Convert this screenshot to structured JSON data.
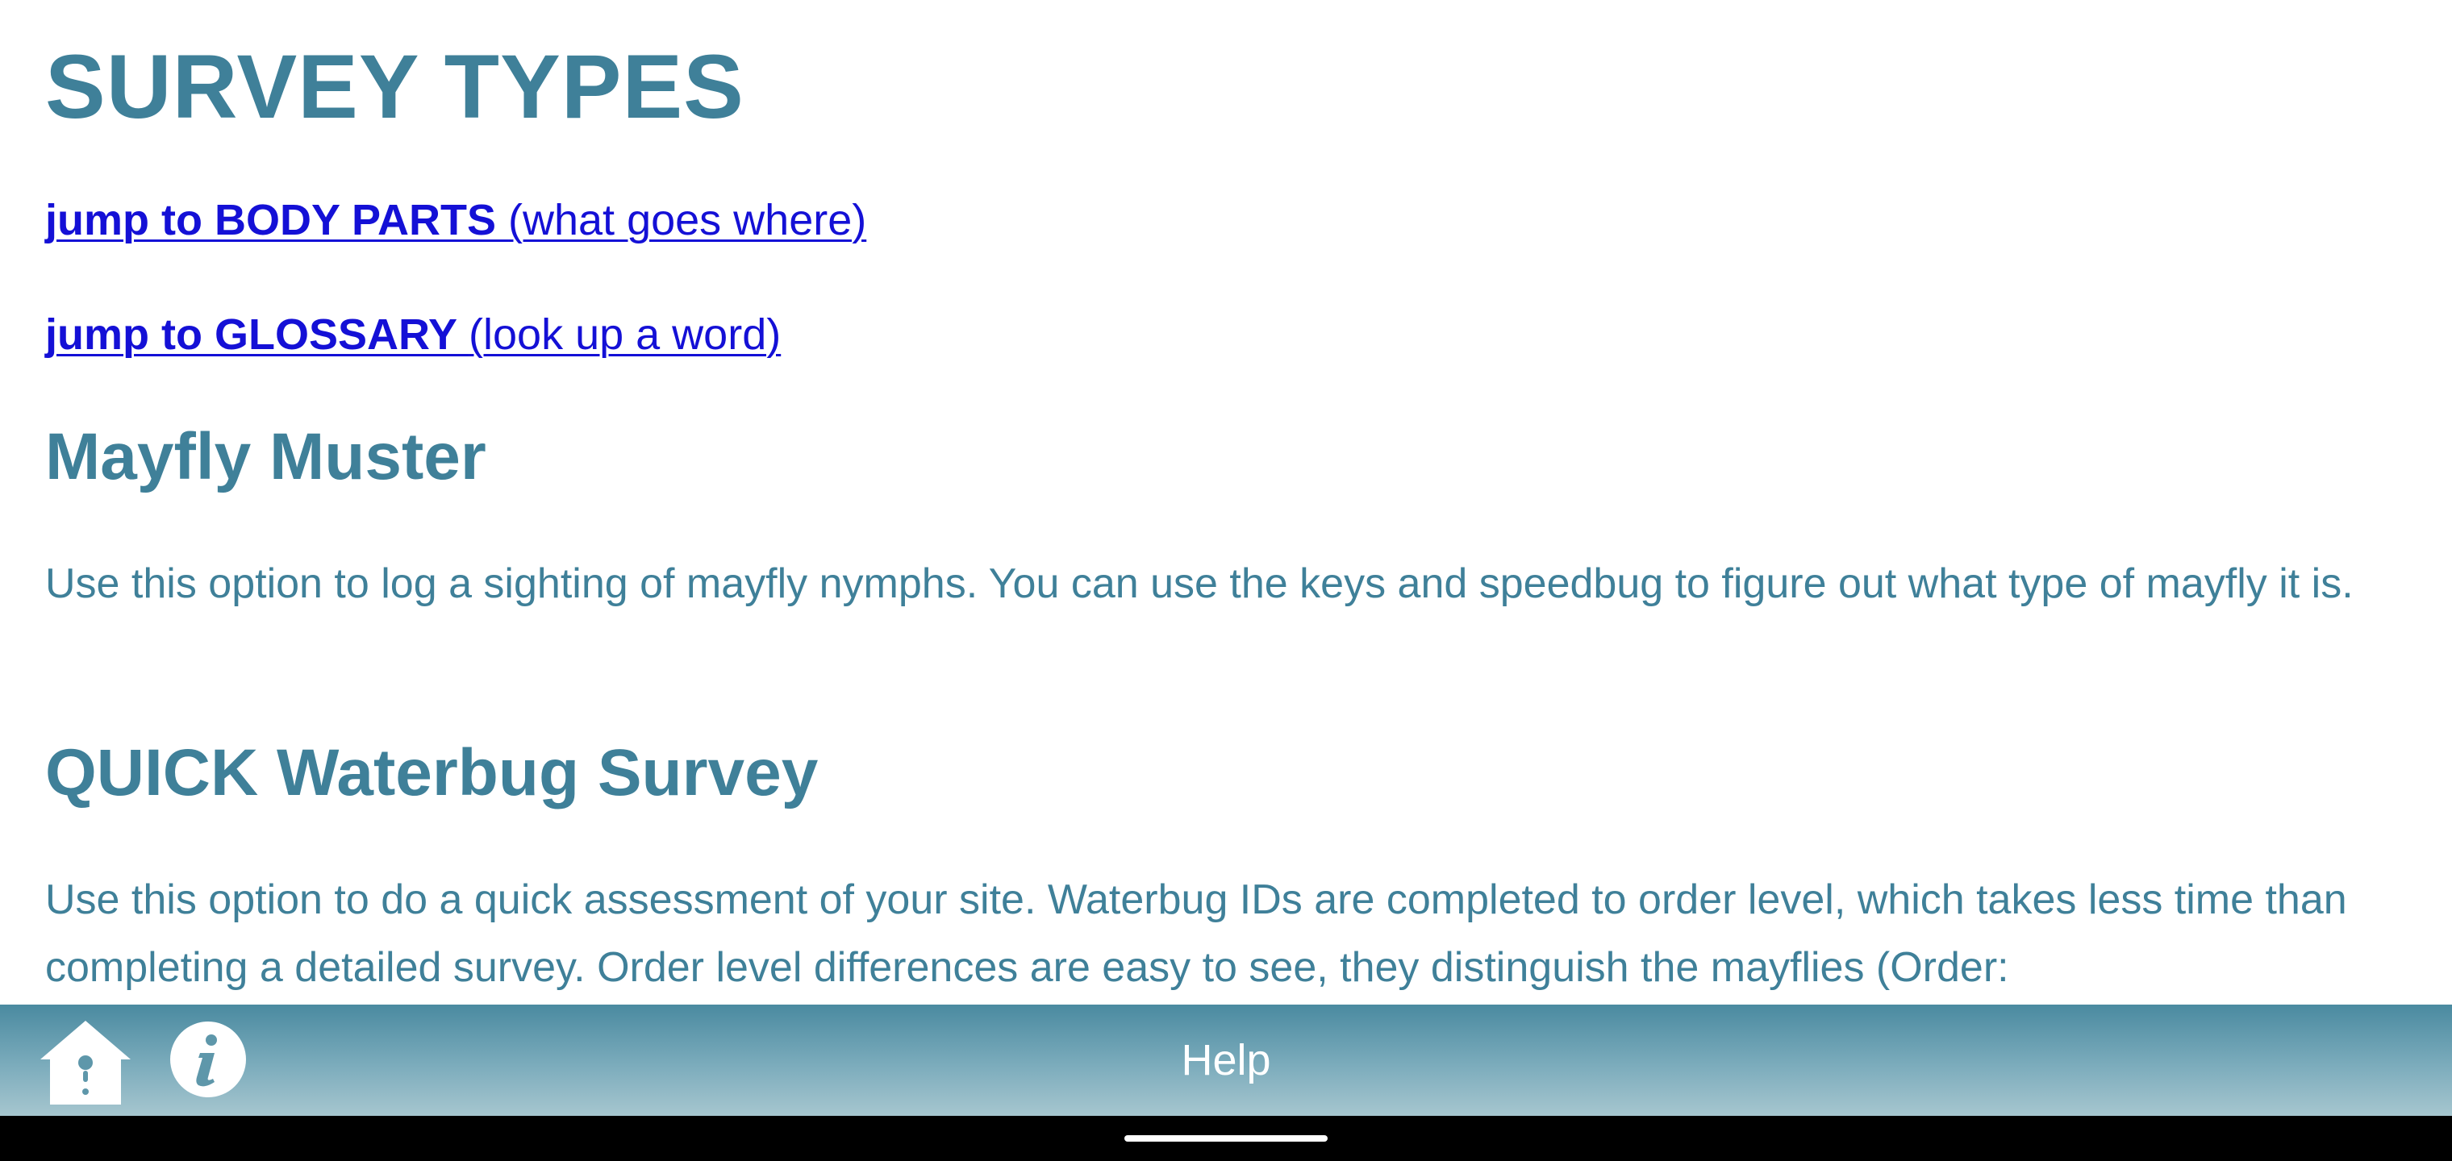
{
  "header": {
    "title": "SURVEY TYPES"
  },
  "links": {
    "body_parts": {
      "strong": "jump to BODY PARTS ",
      "rest": "(what goes where)"
    },
    "glossary": {
      "strong": "jump to GLOSSARY ",
      "rest": "(look up a word)"
    }
  },
  "sections": [
    {
      "heading": "Mayfly Muster",
      "body": "Use this option to log a sighting of mayfly nymphs. You can use the keys and speedbug to figure out what type of mayfly it is."
    },
    {
      "heading": "QUICK Waterbug Survey",
      "body": "Use this option to do a quick assessment of your site. Waterbug IDs are completed to order level, which takes less time than completing a detailed survey. Order level differences are easy to see, they distinguish the mayflies (Order:"
    }
  ],
  "bottom_bar": {
    "title": "Help",
    "home_icon": "home-icon",
    "info_icon": "info-icon"
  },
  "colors": {
    "heading": "#3f8099",
    "link": "#1410d6",
    "bar_top": "#4a8aa0",
    "bar_bottom": "#a6c6cf"
  }
}
